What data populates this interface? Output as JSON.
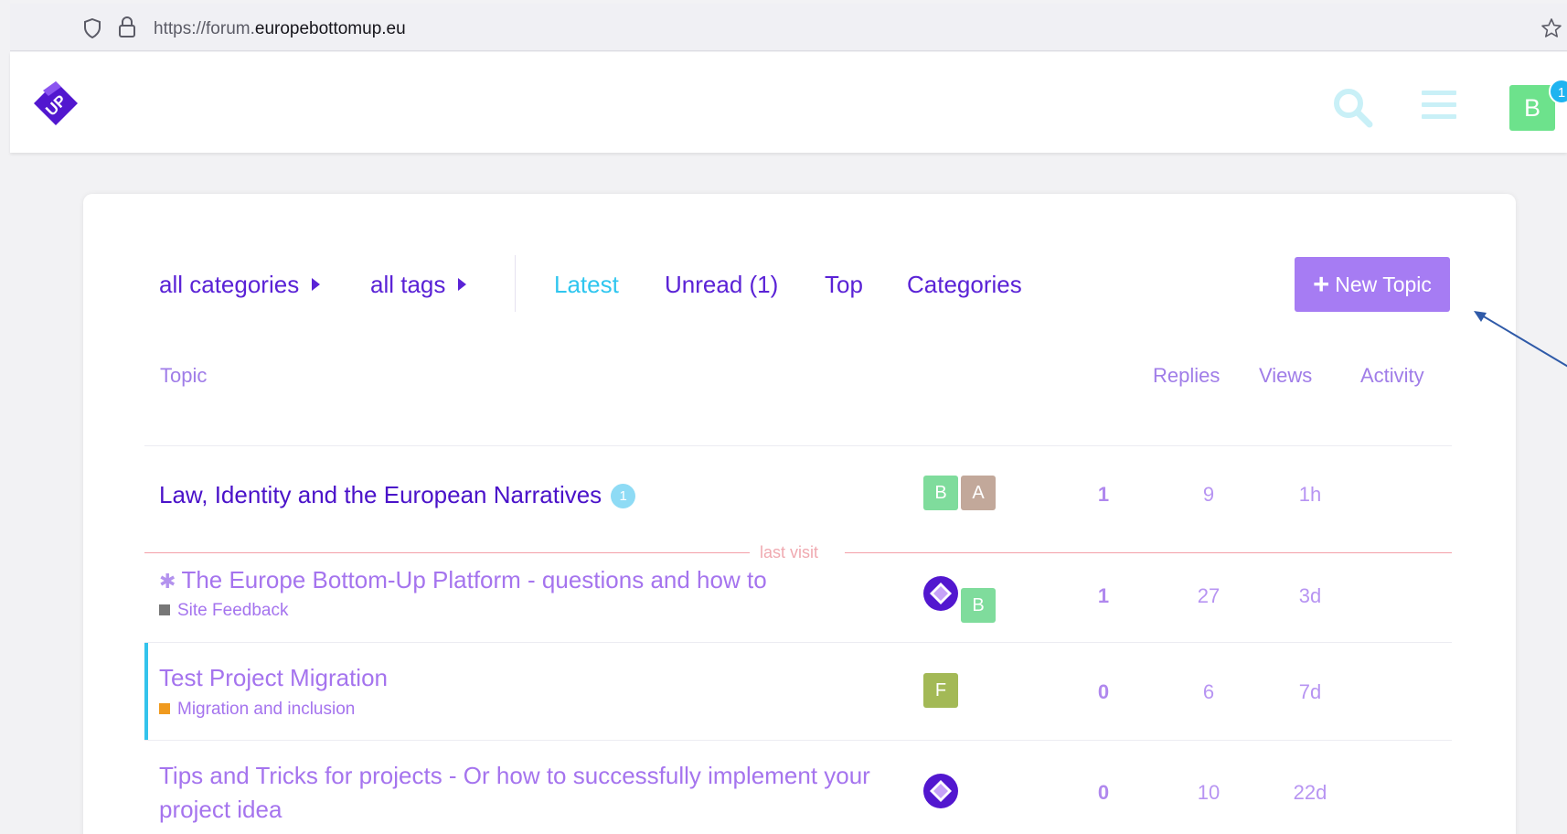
{
  "browser": {
    "url_prefix": "https://forum.",
    "url_domain": "europebottomup.eu"
  },
  "header": {
    "avatar_letter": "B",
    "notification_count": "1"
  },
  "nav": {
    "category_dropdown": "all categories",
    "tag_dropdown": "all tags",
    "tabs": [
      "Latest",
      "Unread (1)",
      "Top",
      "Categories"
    ],
    "active_tab": "Latest",
    "new_topic_label": "New Topic"
  },
  "columns": {
    "topic": "Topic",
    "replies": "Replies",
    "views": "Views",
    "activity": "Activity"
  },
  "last_visit_label": "last visit",
  "topics": [
    {
      "title": "Law, Identity and the European Narratives",
      "unread_badge": "1",
      "category": "",
      "posters": [
        {
          "letter": "B",
          "color": "#7fdc9c"
        },
        {
          "letter": "A",
          "color": "#c2a89a"
        }
      ],
      "replies": "1",
      "views": "9",
      "activity": "1h"
    },
    {
      "title": "The Europe Bottom-Up Platform - questions and how to",
      "pinned": true,
      "category": "Site Feedback",
      "category_color": "#777777",
      "posters": [
        {
          "letter": "",
          "logo": true
        },
        {
          "letter": "B",
          "color": "#7fdc9c"
        }
      ],
      "replies": "1",
      "views": "27",
      "activity": "3d"
    },
    {
      "title": "Test Project Migration",
      "category": "Migration and inclusion",
      "category_color": "#f09a1e",
      "posters": [
        {
          "letter": "F",
          "color": "#a3b956"
        }
      ],
      "replies": "0",
      "views": "6",
      "activity": "7d"
    },
    {
      "title_line1": "Tips and Tricks for projects - Or how to successfully implement your",
      "title_line2": "project idea",
      "category": "",
      "posters": [
        {
          "letter": "",
          "logo": true
        }
      ],
      "replies": "0",
      "views": "10",
      "activity": "22d"
    }
  ],
  "colors": {
    "accent": "#5a22d6",
    "active_tab": "#2fc6ef",
    "new_topic_bg": "#a67cf3"
  }
}
